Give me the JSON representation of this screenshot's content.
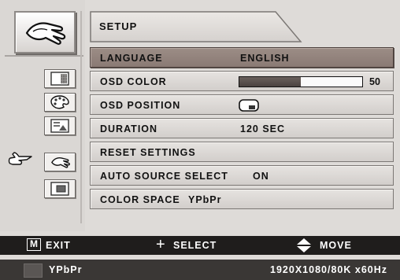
{
  "menu": {
    "title": "SETUP",
    "rows": [
      {
        "label": "LANGUAGE",
        "value": "ENGLISH"
      },
      {
        "label": "OSD COLOR",
        "value": "50"
      },
      {
        "label": "OSD POSITION",
        "value": ""
      },
      {
        "label": "DURATION",
        "value": "120 SEC"
      },
      {
        "label": "RESET SETTINGS",
        "value": ""
      },
      {
        "label": "AUTO SOURCE SELECT",
        "value": "ON"
      },
      {
        "label": "COLOR SPACE",
        "value": "YPbPr"
      }
    ],
    "selected_row": "LANGUAGE",
    "osd_color_level": 0.5
  },
  "sidebar": {
    "icons": [
      "hand-setup-icon",
      "picture-icon",
      "palette-icon",
      "image-adjust-icon",
      "hand-setup-icon",
      "input-source-icon"
    ],
    "active": "hand-setup-icon"
  },
  "nav": {
    "exit_key": "M",
    "exit_label": "EXIT",
    "select_label": "SELECT",
    "move_label": "MOVE"
  },
  "status": {
    "source": "YPbPr",
    "resolution": "1920X1080/80K x60Hz"
  }
}
